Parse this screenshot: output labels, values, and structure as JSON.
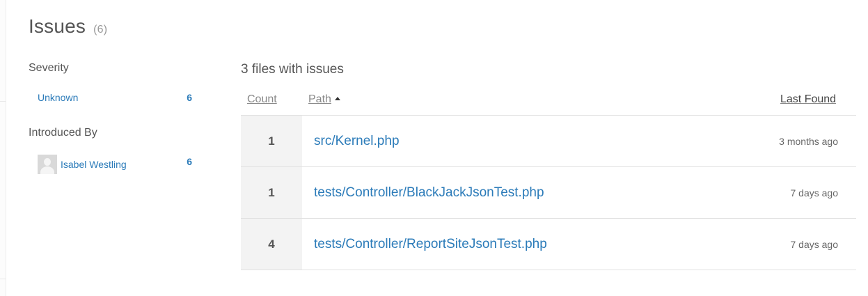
{
  "header": {
    "title": "Issues",
    "count": "(6)"
  },
  "facets": {
    "severity": {
      "heading": "Severity",
      "items": [
        {
          "label": "Unknown",
          "count": "6"
        }
      ]
    },
    "introduced_by": {
      "heading": "Introduced By",
      "items": [
        {
          "label": "Isabel Westling",
          "count": "6",
          "icon": "default-avatar-icon"
        }
      ]
    }
  },
  "files": {
    "heading": "3 files with issues",
    "columns": {
      "count": "Count",
      "path": "Path",
      "last_found": "Last Found"
    },
    "sort": {
      "column": "path",
      "direction": "ascending",
      "icon": "sort-ascending-icon"
    },
    "rows": [
      {
        "count": "1",
        "path": "src/Kernel.php",
        "last_found": "3 months ago"
      },
      {
        "count": "1",
        "path": "tests/Controller/BlackJackJsonTest.php",
        "last_found": "7 days ago"
      },
      {
        "count": "4",
        "path": "tests/Controller/ReportSiteJsonTest.php",
        "last_found": "7 days ago"
      }
    ]
  },
  "colors": {
    "link": "#2b7bb9",
    "count_cell_bg": "#f3f3f3",
    "divider": "#e0e0e0"
  }
}
